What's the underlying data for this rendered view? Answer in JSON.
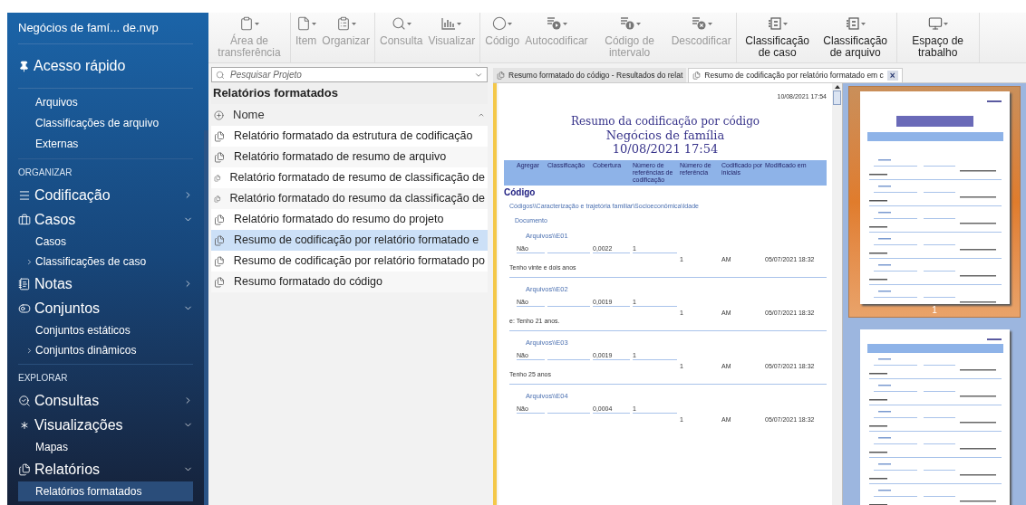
{
  "sidebar": {
    "project_title": "Negócios de famí... de.nvp",
    "quick_access": {
      "label": "Acesso rápido",
      "items": [
        {
          "label": "Arquivos"
        },
        {
          "label": "Classificações de arquivo"
        },
        {
          "label": "Externas"
        }
      ]
    },
    "sections": [
      {
        "heading": "ORGANIZAR",
        "groups": [
          {
            "label": "Codificação",
            "expanded": false
          },
          {
            "label": "Casos",
            "expanded": true,
            "children": [
              {
                "label": "Casos",
                "expandable": false,
                "selected": false
              },
              {
                "label": "Classificações de caso",
                "expandable": true,
                "selected": false
              }
            ]
          },
          {
            "label": "Notas",
            "expanded": false
          },
          {
            "label": "Conjuntos",
            "expanded": true,
            "children": [
              {
                "label": "Conjuntos estáticos",
                "expandable": false,
                "selected": false
              },
              {
                "label": "Conjuntos dinâmicos",
                "expandable": true,
                "selected": false
              }
            ]
          }
        ]
      },
      {
        "heading": "EXPLORAR",
        "groups": [
          {
            "label": "Consultas",
            "expanded": false
          },
          {
            "label": "Visualizações",
            "expanded": true,
            "children": [
              {
                "label": "Mapas",
                "expandable": false,
                "selected": false
              }
            ]
          },
          {
            "label": "Relatórios",
            "expanded": true,
            "children": [
              {
                "label": "Relatórios formatados",
                "expandable": false,
                "selected": true
              }
            ]
          }
        ]
      }
    ]
  },
  "toolbar": {
    "groups": [
      [
        {
          "label": "Área de transferência",
          "disabled": true
        }
      ],
      [
        {
          "label": "Item",
          "disabled": true
        },
        {
          "label": "Organizar",
          "disabled": true
        }
      ],
      [
        {
          "label": "Consulta",
          "disabled": true
        },
        {
          "label": "Visualizar",
          "disabled": true
        }
      ],
      [
        {
          "label": "Código",
          "disabled": true
        },
        {
          "label": "Autocodificar",
          "disabled": true
        },
        {
          "label": "Código de intervalo",
          "disabled": true
        },
        {
          "label": "Descodificar",
          "disabled": true
        }
      ],
      [
        {
          "label": "Classificação de caso",
          "disabled": false
        },
        {
          "label": "Classificação de arquivo",
          "disabled": false
        }
      ],
      [
        {
          "label": "Espaço de trabalho",
          "disabled": false
        }
      ]
    ]
  },
  "search": {
    "placeholder": "Pesquisar Projeto"
  },
  "list": {
    "title": "Relatórios formatados",
    "column": "Nome",
    "rows": [
      {
        "name": "Relatório formatado da estrutura de codificação",
        "selected": false
      },
      {
        "name": "Relatório formatado de resumo de arquivo",
        "selected": false
      },
      {
        "name": "Relatório formatado de resumo de classificação de",
        "selected": false
      },
      {
        "name": "Relatório formatado do resumo da classificação de",
        "selected": false
      },
      {
        "name": "Relatório formatado do resumo do projeto",
        "selected": false
      },
      {
        "name": "Resumo de codificação por relatório formatado e",
        "selected": true
      },
      {
        "name": "Resumo de codificação por relatório formatado po",
        "selected": false
      },
      {
        "name": "Resumo formatado do código",
        "selected": false
      }
    ]
  },
  "tabs": [
    {
      "label": "Resumo formatado do código - Resultados do relat",
      "selected": false
    },
    {
      "label": "Resumo de codificação por relatório formatado em c",
      "selected": true,
      "close": "×"
    }
  ],
  "report": {
    "date": "10/08/2021 17:54",
    "title_lines": [
      "Resumo da codificação por código",
      "Negócios de família",
      "10/08/2021 17:54"
    ],
    "columns": [
      "Agregar",
      "Classificação",
      "Cobertura",
      "Número de referências de codificação",
      "Número de referência",
      "Codificado por iniciais",
      "Modificado em"
    ],
    "section": "Código",
    "path": "Códigos\\\\Caracterização e trajetória familiar\\Socioeconômica\\Idade",
    "group": "Documento",
    "entries": [
      {
        "heading": "Arquivos\\\\E01",
        "aggregate": "Não",
        "coverage": "0,0022",
        "coding_refs": "1",
        "refs": "1",
        "initials": "AM",
        "modified": "05/07/2021 18:32",
        "quote": "Tenho vinte e dois anos"
      },
      {
        "heading": "Arquivos\\\\E02",
        "aggregate": "Não",
        "coverage": "0,0019",
        "coding_refs": "1",
        "refs": "1",
        "initials": "AM",
        "modified": "05/07/2021 18:32",
        "quote": "e: Tenho 21 anos."
      },
      {
        "heading": "Arquivos\\\\E03",
        "aggregate": "Não",
        "coverage": "0,0019",
        "coding_refs": "1",
        "refs": "1",
        "initials": "AM",
        "modified": "05/07/2021 18:32",
        "quote": "Tenho 25 anos"
      },
      {
        "heading": "Arquivos\\\\E04",
        "aggregate": "Não",
        "coverage": "0,0004",
        "coding_refs": "1",
        "refs": "1",
        "initials": "AM",
        "modified": "05/07/2021 18:32"
      }
    ]
  },
  "thumbnails": [
    {
      "page": "1",
      "selected": true
    },
    {
      "selected": false
    }
  ]
}
